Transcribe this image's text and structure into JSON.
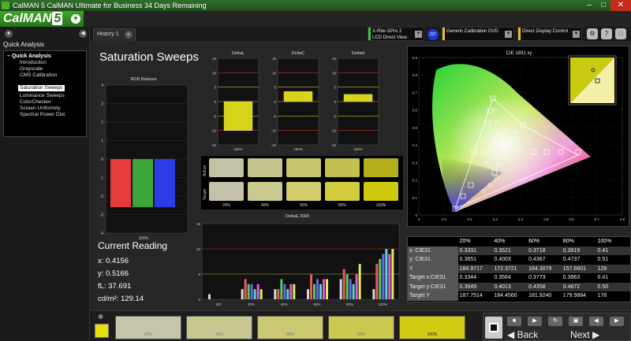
{
  "title": "CalMAN 5 CalMAN Ultimate for Business 34 Days Remaining",
  "logo": {
    "text": "CalMAN",
    "version": "5"
  },
  "sidebar": {
    "header": "Quick Analysis",
    "root": "Quick Analysis",
    "items": [
      "Introduction",
      "Grayscale",
      "CMS Calibration",
      "Saturation Sweeps",
      "Luminance Sweeps",
      "ColorChecker",
      "Screen Uniformity",
      "Spectral Power Dist."
    ],
    "selected_index": 3
  },
  "tabs": [
    {
      "label": "History 1"
    }
  ],
  "devices": {
    "meter": {
      "line1": "X-Rite i1Pro 2",
      "line2": "LCD Direct View",
      "badge": "237",
      "color": "#3cc43c"
    },
    "source": {
      "line1": "Generic Calibration DVD",
      "color": "#e4c21a"
    },
    "display": {
      "line1": "Direct Display Control",
      "color": "#e4c21a"
    }
  },
  "page_title": "Saturation Sweeps",
  "current_reading": {
    "title": "Current Reading",
    "x": "x: 0.4156",
    "y": "y: 0.5166",
    "fl": "fL: 37.691",
    "cd": "cd/m²: 129.14"
  },
  "rgb_balance": {
    "title": "RGB Balance",
    "yticks": [
      "4",
      "3",
      "2",
      "1",
      "0",
      "-1",
      "-2",
      "-3",
      "-4"
    ],
    "xlabel": "100%",
    "bars": [
      {
        "value": -2.6,
        "color": "#e63b3b"
      },
      {
        "value": -2.6,
        "color": "#3da43a"
      },
      {
        "value": -2.6,
        "color": "#2d3de6"
      }
    ]
  },
  "small_charts": [
    {
      "title": "DeltaL",
      "xlabel": "100%",
      "yticks": [
        "15",
        "10",
        "5",
        "0",
        "-5",
        "-10",
        "-15"
      ],
      "min": -10,
      "max": 0
    },
    {
      "title": "DeltaC",
      "xlabel": "100%",
      "yticks": [
        "15",
        "10",
        "5",
        "0",
        "-5",
        "-10",
        "-15"
      ],
      "min": 0,
      "max": 3.5
    },
    {
      "title": "DeltaH",
      "xlabel": "100%",
      "yticks": [
        "15",
        "10",
        "5",
        "0",
        "-5",
        "-10",
        "-15"
      ],
      "min": 0,
      "max": 2.5
    }
  ],
  "swatches": {
    "row_labels": [
      "Actual",
      "Target"
    ],
    "labels": [
      "20%",
      "40%",
      "60%",
      "80%",
      "100%"
    ],
    "actual": [
      "#c3c2a6",
      "#c5c48c",
      "#c7c56e",
      "#c3c04f",
      "#b2af1a"
    ],
    "target": [
      "#c4c3aa",
      "#cbca8e",
      "#d1cd6c",
      "#d1cb3e",
      "#d0c90f"
    ]
  },
  "chart_data": {
    "type": "bar",
    "title": "DeltaE 2000",
    "categories": [
      "100",
      "20%",
      "40%",
      "60%",
      "80%",
      "100%"
    ],
    "ylim": [
      0,
      15
    ],
    "yticks": [
      "15",
      "10",
      "5",
      "0"
    ],
    "series": [
      {
        "color": "#d8d8d8",
        "values": [
          1,
          2,
          2,
          2,
          4,
          2
        ]
      },
      {
        "color": "#e85a5a",
        "values": [
          0,
          4,
          2,
          5,
          6,
          7
        ]
      },
      {
        "color": "#5cc55c",
        "values": [
          0,
          3,
          4,
          3,
          5,
          8
        ]
      },
      {
        "color": "#5a6ee8",
        "values": [
          0,
          3,
          3,
          4,
          4,
          9
        ]
      },
      {
        "color": "#5ad0d8",
        "values": [
          0,
          2,
          2,
          3,
          3,
          10
        ]
      },
      {
        "color": "#d860d0",
        "values": [
          0,
          3,
          3,
          4,
          5,
          9
        ]
      },
      {
        "color": "#e8e85a",
        "values": [
          0,
          2,
          3,
          4,
          7,
          10
        ]
      }
    ]
  },
  "cie_chart": {
    "title": "CIE 1931 xy",
    "xticks": [
      "0",
      "0.1",
      "0.2",
      "0.3",
      "0.4",
      "0.5",
      "0.6",
      "0.7",
      "0.8"
    ],
    "yticks": [
      "0.9",
      "0.8",
      "0.7",
      "0.6",
      "0.5",
      "0.4",
      "0.3",
      "0.2",
      "0.1",
      "0"
    ]
  },
  "data_table": {
    "headers": [
      "",
      "20%",
      "40%",
      "60%",
      "80%",
      "100%"
    ],
    "rows": [
      {
        "label": "x: CIE31",
        "values": [
          "0.3331",
          "0.3521",
          "0.3718",
          "0.3919",
          "0.41"
        ]
      },
      {
        "label": "y: CIE31",
        "values": [
          "0.3651",
          "0.4003",
          "0.4367",
          "0.4737",
          "0.51"
        ]
      },
      {
        "label": "Y",
        "values": [
          "184.9717",
          "172.3721",
          "164.3079",
          "157.6601",
          "129"
        ]
      },
      {
        "label": "Target x:CIE31",
        "values": [
          "0.3344",
          "0.3564",
          "0.3773",
          "0.3963",
          "0.41"
        ]
      },
      {
        "label": "Target y:CIE31",
        "values": [
          "0.3649",
          "0.4013",
          "0.4358",
          "0.4672",
          "0.50"
        ]
      },
      {
        "label": "Target Y",
        "values": [
          "187.7514",
          "184.4560",
          "181.9240",
          "179.9884",
          "178"
        ]
      }
    ]
  },
  "bottom": {
    "current_color": "#e8e00c",
    "strips": [
      {
        "label": "20%",
        "color": "#c7c6ad"
      },
      {
        "label": "40%",
        "color": "#c9c791"
      },
      {
        "label": "60%",
        "color": "#cbc872"
      },
      {
        "label": "80%",
        "color": "#cdc84f"
      },
      {
        "label": "100%",
        "color": "#d2cb12"
      }
    ],
    "back_label": "Back",
    "next_label": "Next"
  }
}
